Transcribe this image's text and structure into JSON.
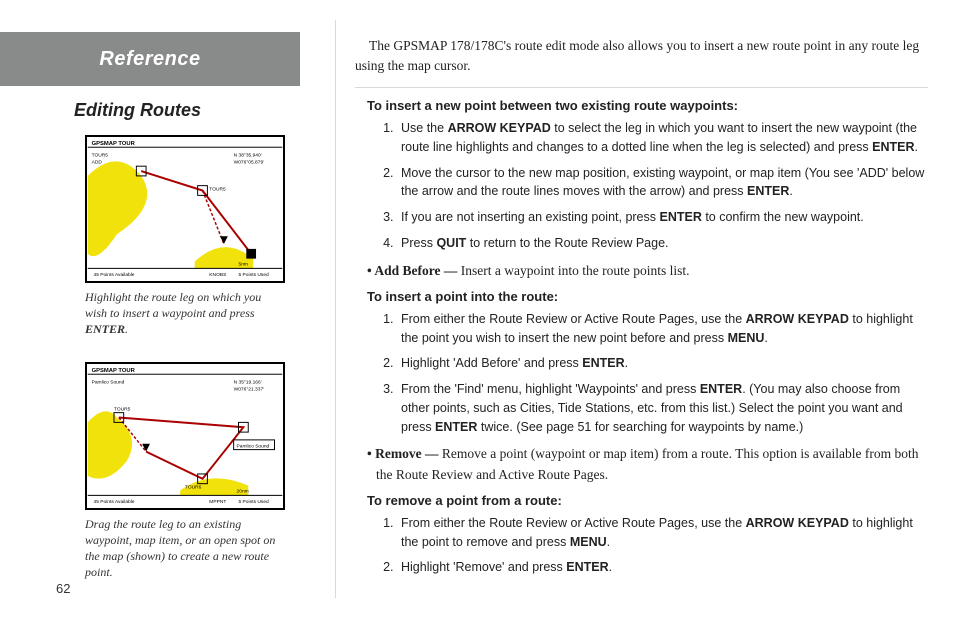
{
  "page_number": "62",
  "left": {
    "reference": "Reference",
    "section_title": "Editing Routes",
    "fig1_caption_a": "Highlight the route leg on which you wish to insert a waypoint and press ",
    "fig1_caption_b": "ENTER",
    "fig1_caption_c": ".",
    "fig2_caption": "Drag the route leg to an existing waypoint, map item, or an open spot on the map (shown) to create a new route point."
  },
  "right": {
    "intro": "The GPSMAP 178/178C's route edit mode also allows you to insert a new route point in any route leg using the map cursor.",
    "h1": "To insert a new point between two existing route waypoints:",
    "s1_1a": "Use the ",
    "s1_1b": "ARROW KEYPAD",
    "s1_1c": " to select the leg in which you want to insert the new waypoint (the route line highlights and changes to a dotted line when the leg is selected) and press ",
    "s1_1d": "ENTER",
    "s1_1e": ".",
    "s1_2a": "Move the cursor to the new map position, existing waypoint, or map item (You see 'ADD' below the arrow and the route lines moves with the arrow) and press ",
    "s1_2b": "ENTER",
    "s1_2c": ".",
    "s1_3a": "If you are not inserting an existing point, press ",
    "s1_3b": "ENTER",
    "s1_3c": " to confirm the new waypoint.",
    "s1_4a": "Press ",
    "s1_4b": "QUIT",
    "s1_4c": " to return to the Route Review Page.",
    "bullet1_lead": "• Add Before —",
    "bullet1_rest": " Insert a waypoint into the route points list.",
    "h2": "To insert a point into the route:",
    "s2_1a": "From either the Route Review or Active Route Pages, use the ",
    "s2_1b": "ARROW KEYPAD",
    "s2_1c": " to highlight the point you wish to insert the new point before and press ",
    "s2_1d": "MENU",
    "s2_1e": ".",
    "s2_2a": "Highlight 'Add Before' and press ",
    "s2_2b": "ENTER",
    "s2_2c": ".",
    "s2_3a": "From the 'Find' menu, highlight 'Waypoints' and press ",
    "s2_3b": "ENTER",
    "s2_3c": ". (You may also choose from other points, such as Cities, Tide Stations, etc. from this list.) Select the point you want and press ",
    "s2_3d": "ENTER",
    "s2_3e": " twice. (See page 51 for searching for waypoints by name.)",
    "bullet2_lead": "• Remove —",
    "bullet2_rest": " Remove a point (waypoint or map item) from a route. This option is available from both the Route Review and Active Route Pages.",
    "h3": "To remove a point from a route:",
    "s3_1a": "From either the Route Review or Active Route Pages, use the ",
    "s3_1b": "ARROW KEYPAD",
    "s3_1c": " to highlight the point to remove and press ",
    "s3_1d": "MENU",
    "s3_1e": ".",
    "s3_2a": "Highlight 'Remove' and press ",
    "s3_2b": "ENTER",
    "s3_2c": "."
  }
}
